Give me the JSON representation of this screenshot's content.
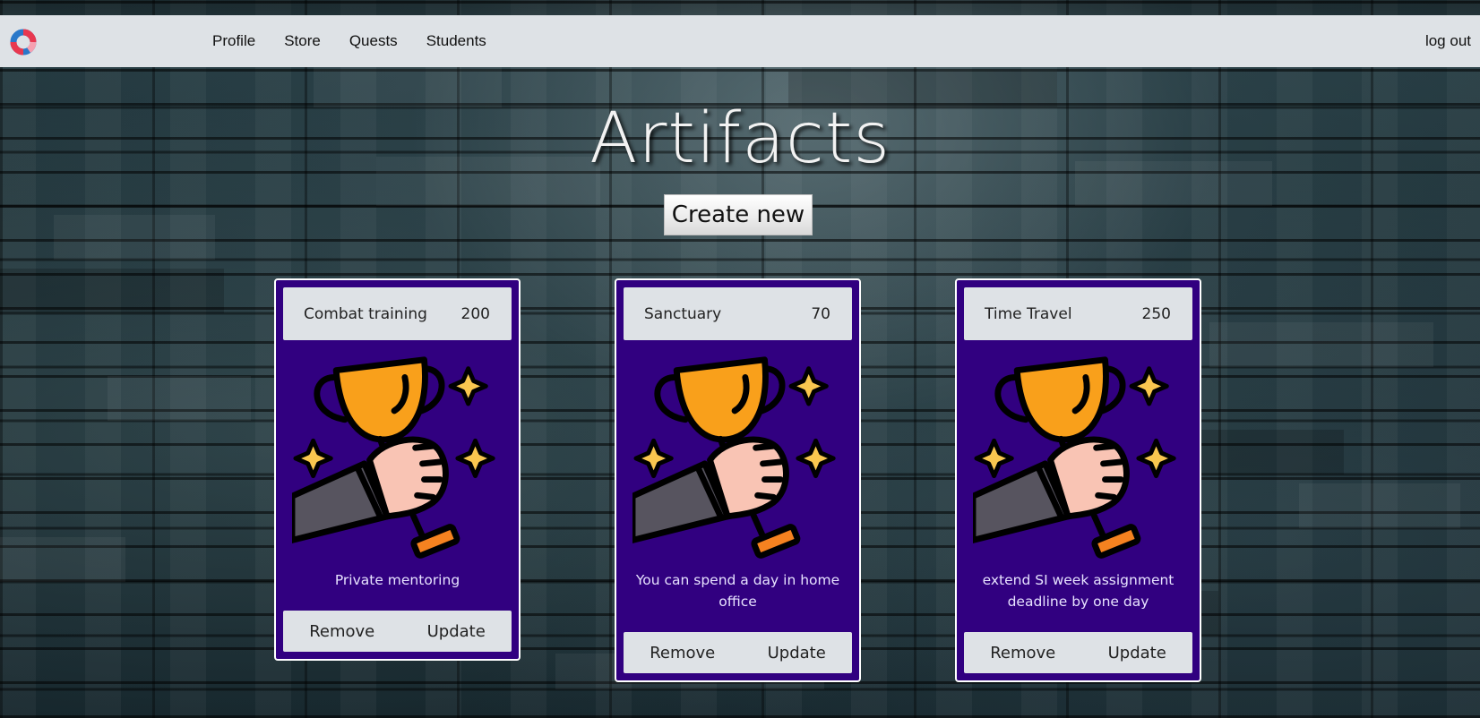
{
  "nav": {
    "links": [
      {
        "label": "Profile"
      },
      {
        "label": "Store"
      },
      {
        "label": "Quests"
      },
      {
        "label": "Students"
      }
    ],
    "logout_label": "log out"
  },
  "page": {
    "title": "Artifacts",
    "create_label": "Create new"
  },
  "cards": [
    {
      "name": "Combat training",
      "price": "200",
      "description": "Private mentoring",
      "remove_label": "Remove",
      "update_label": "Update"
    },
    {
      "name": "Sanctuary",
      "price": "70",
      "description": "You can spend a day in home office",
      "remove_label": "Remove",
      "update_label": "Update"
    },
    {
      "name": "Time Travel",
      "price": "250",
      "description": "extend SI week assignment deadline by one day",
      "remove_label": "Remove",
      "update_label": "Update"
    }
  ],
  "icons": {
    "logo": "ring-logo-icon",
    "card_image": "trophy-hand-icon"
  },
  "colors": {
    "navbar": "#dee2e6",
    "card_bg": "#310080",
    "trophy": "#f9a01b",
    "sparkle": "#f9c74f",
    "hand": "#f9c4b4",
    "sleeve": "#57545f"
  }
}
